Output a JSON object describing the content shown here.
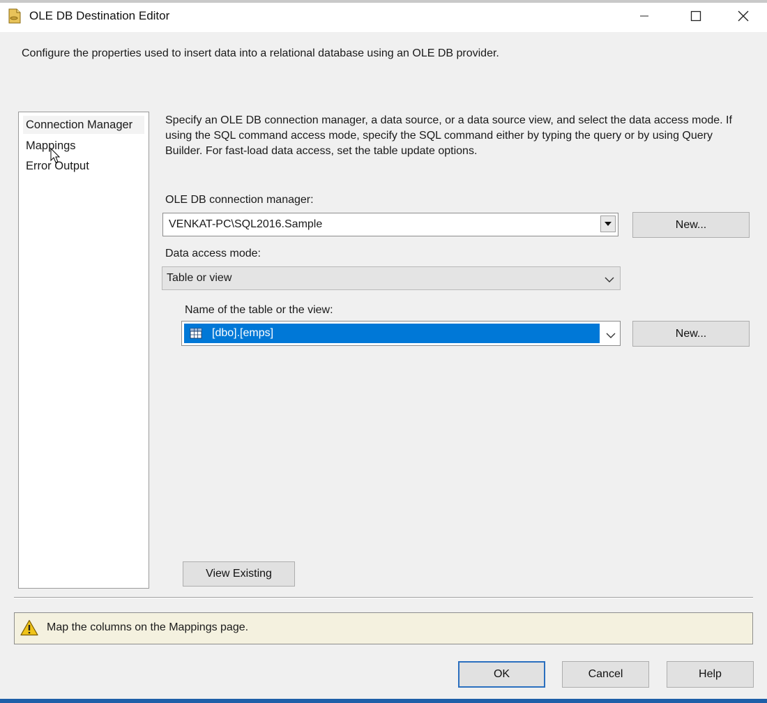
{
  "window": {
    "title": "OLE DB Destination Editor",
    "icon": "database-file-icon"
  },
  "description": "Configure the properties used to insert data into a relational database using an OLE DB provider.",
  "nav": {
    "items": [
      {
        "label": "Connection Manager",
        "selected": true
      },
      {
        "label": "Mappings",
        "selected": false
      },
      {
        "label": "Error Output",
        "selected": false
      }
    ]
  },
  "main": {
    "instructions": "Specify an OLE DB connection manager, a data source, or a data source view, and select the data access mode. If using the SQL command access mode, specify the SQL command either by typing the query or by using Query Builder. For fast-load data access, set the table update options.",
    "connection_label": "OLE DB connection manager:",
    "connection_value": "VENKAT-PC\\SQL2016.Sample",
    "connection_new": "New...",
    "access_mode_label": "Data access mode:",
    "access_mode_value": "Table or view",
    "table_label": "Name of the table or the view:",
    "table_value": "[dbo].[emps]",
    "table_new": "New...",
    "view_existing": "View Existing"
  },
  "message": {
    "text": "Map the columns on the Mappings page.",
    "icon": "warning-icon"
  },
  "buttons": {
    "ok": "OK",
    "cancel": "Cancel",
    "help": "Help"
  },
  "colors": {
    "selection": "#0078d7",
    "message_bg": "#f4f1df",
    "dialog_bg": "#f0f0f0"
  }
}
